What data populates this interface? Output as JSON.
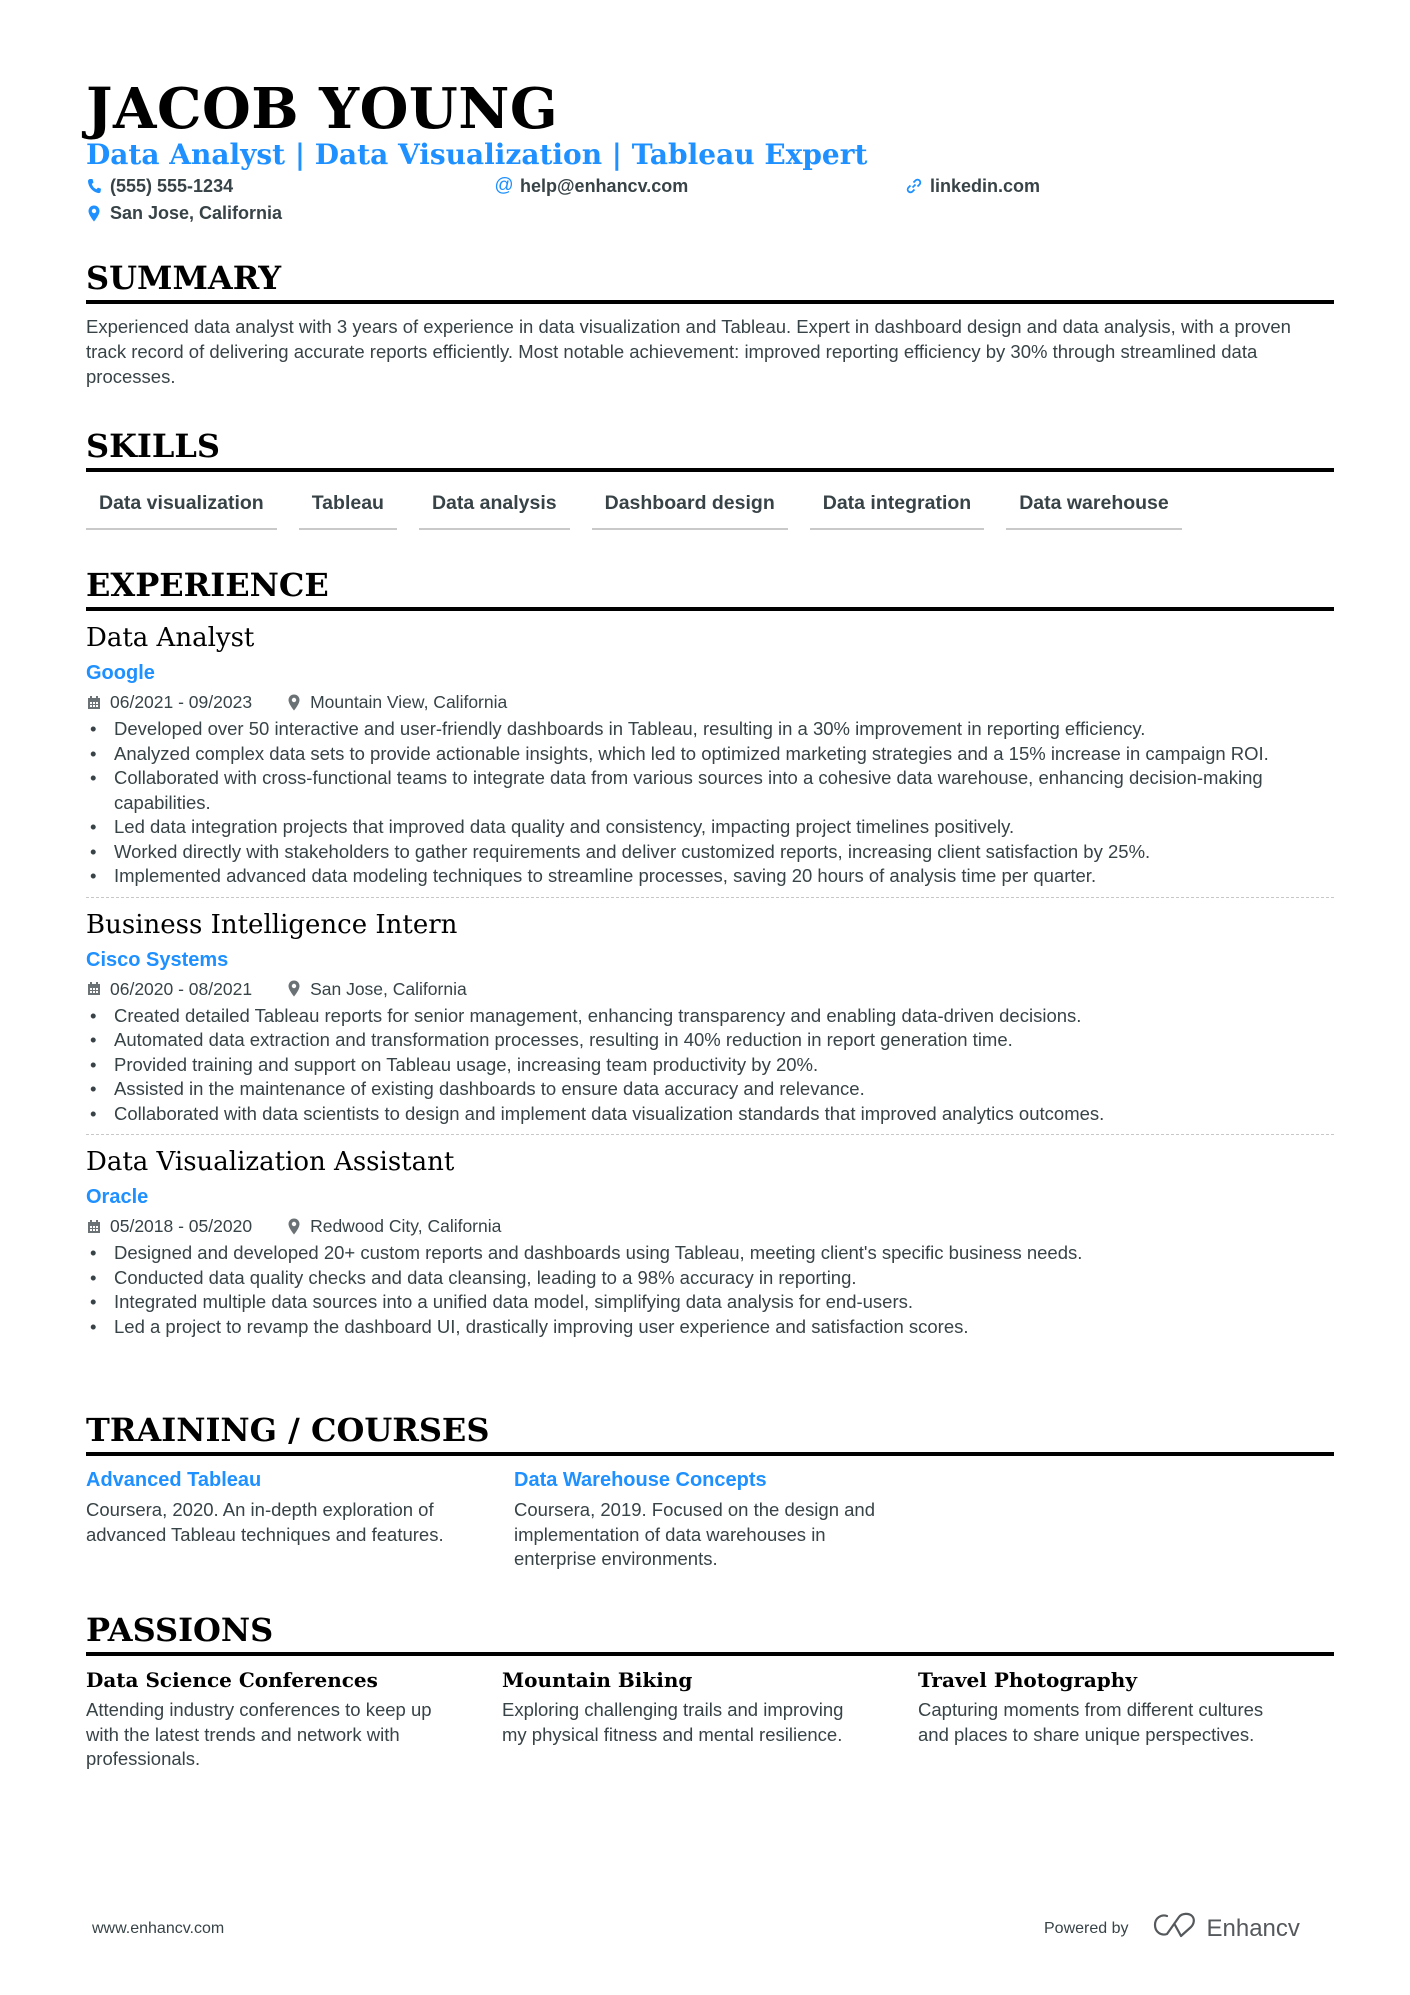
{
  "header": {
    "name": "JACOB YOUNG",
    "headline": "Data Analyst | Data Visualization | Tableau Expert",
    "contacts": {
      "phone": "(555) 555-1234",
      "email": "help@enhancv.com",
      "link": "linkedin.com",
      "location": "San Jose, California"
    },
    "accent_color": "#1e90ff"
  },
  "summary": {
    "title": "SUMMARY",
    "text": "Experienced data analyst with 3 years of experience in data visualization and Tableau. Expert in dashboard design and data analysis, with a proven track record of delivering accurate reports efficiently. Most notable achievement: improved reporting efficiency by 30% through streamlined data processes."
  },
  "skills": {
    "title": "SKILLS",
    "items": [
      "Data visualization",
      "Tableau",
      "Data analysis",
      "Dashboard design",
      "Data integration",
      "Data warehouse"
    ]
  },
  "experience": {
    "title": "EXPERIENCE",
    "jobs": [
      {
        "title": "Data Analyst",
        "company": "Google",
        "dates": "06/2021 - 09/2023",
        "location": "Mountain View, California",
        "bullets": [
          "Developed over 50 interactive and user-friendly dashboards in Tableau, resulting in a 30% improvement in reporting efficiency.",
          "Analyzed complex data sets to provide actionable insights, which led to optimized marketing strategies and a 15% increase in campaign ROI.",
          "Collaborated with cross-functional teams to integrate data from various sources into a cohesive data warehouse, enhancing decision-making capabilities.",
          "Led data integration projects that improved data quality and consistency, impacting project timelines positively.",
          "Worked directly with stakeholders to gather requirements and deliver customized reports, increasing client satisfaction by 25%.",
          "Implemented advanced data modeling techniques to streamline processes, saving 20 hours of analysis time per quarter."
        ]
      },
      {
        "title": "Business Intelligence Intern",
        "company": "Cisco Systems",
        "dates": "06/2020 - 08/2021",
        "location": "San Jose, California",
        "bullets": [
          "Created detailed Tableau reports for senior management, enhancing transparency and enabling data-driven decisions.",
          "Automated data extraction and transformation processes, resulting in 40% reduction in report generation time.",
          "Provided training and support on Tableau usage, increasing team productivity by 20%.",
          "Assisted in the maintenance of existing dashboards to ensure data accuracy and relevance.",
          "Collaborated with data scientists to design and implement data visualization standards that improved analytics outcomes."
        ]
      },
      {
        "title": "Data Visualization Assistant",
        "company": "Oracle",
        "dates": "05/2018 - 05/2020",
        "location": "Redwood City, California",
        "bullets": [
          "Designed and developed 20+ custom reports and dashboards using Tableau, meeting client's specific business needs.",
          "Conducted data quality checks and data cleansing, leading to a 98% accuracy in reporting.",
          "Integrated multiple data sources into a unified data model, simplifying data analysis for end-users.",
          "Led a project to revamp the dashboard UI, drastically improving user experience and satisfaction scores."
        ]
      }
    ]
  },
  "training": {
    "title": "TRAINING / COURSES",
    "items": [
      {
        "title": "Advanced Tableau",
        "desc": "Coursera, 2020. An in-depth exploration of advanced Tableau techniques and features."
      },
      {
        "title": "Data Warehouse Concepts",
        "desc": "Coursera, 2019. Focused on the design and implementation of data warehouses in enterprise environments."
      }
    ]
  },
  "passions": {
    "title": "PASSIONS",
    "items": [
      {
        "title": "Data Science Conferences",
        "desc": "Attending industry conferences to keep up with the latest trends and network with professionals."
      },
      {
        "title": "Mountain Biking",
        "desc": "Exploring challenging trails and improving my physical fitness and mental resilience."
      },
      {
        "title": "Travel Photography",
        "desc": "Capturing moments from different cultures and places to share unique perspectives."
      }
    ]
  },
  "footer": {
    "website": "www.enhancv.com",
    "powered_by": "Powered by",
    "brand": "Enhancv"
  },
  "icons": {
    "phone": "phone-icon",
    "email": "at-icon",
    "link": "link-icon",
    "location": "map-pin-icon",
    "date": "calendar-icon"
  }
}
